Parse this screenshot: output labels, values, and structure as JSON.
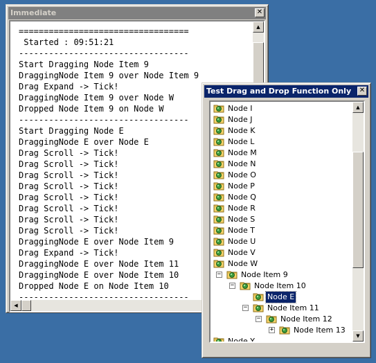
{
  "immediate": {
    "title": "Immediate",
    "close_glyph": "✕",
    "lines": [
      "==================================",
      " Started : 09:51:21",
      "----------------------------------",
      "Start Dragging Node Item 9",
      "DraggingNode Item 9 over Node Item 9",
      "Drag Expand -> Tick!",
      "DraggingNode Item 9 over Node W",
      "Dropped Node Item 9 on Node W",
      "----------------------------------",
      "Start Dragging Node E",
      "DraggingNode E over Node E",
      "Drag Scroll -> Tick!",
      "Drag Scroll -> Tick!",
      "Drag Scroll -> Tick!",
      "Drag Scroll -> Tick!",
      "Drag Scroll -> Tick!",
      "Drag Scroll -> Tick!",
      "Drag Scroll -> Tick!",
      "Drag Scroll -> Tick!",
      "DraggingNode E over Node Item 9",
      "Drag Expand -> Tick!",
      "DraggingNode E over Node Item 11",
      "DraggingNode E over Node Item 10",
      "Dropped Node E on Node Item 10",
      "----------------------------------"
    ]
  },
  "dialog": {
    "title": "Test Drag and Drop Function Only",
    "close_glyph": "✕",
    "tree": [
      {
        "label": "Node I",
        "level": 0
      },
      {
        "label": "Node J",
        "level": 0
      },
      {
        "label": "Node K",
        "level": 0
      },
      {
        "label": "Node L",
        "level": 0
      },
      {
        "label": "Node M",
        "level": 0
      },
      {
        "label": "Node N",
        "level": 0
      },
      {
        "label": "Node O",
        "level": 0
      },
      {
        "label": "Node P",
        "level": 0
      },
      {
        "label": "Node Q",
        "level": 0
      },
      {
        "label": "Node R",
        "level": 0
      },
      {
        "label": "Node S",
        "level": 0
      },
      {
        "label": "Node T",
        "level": 0
      },
      {
        "label": "Node U",
        "level": 0
      },
      {
        "label": "Node V",
        "level": 0
      },
      {
        "label": "Node W",
        "level": 0
      },
      {
        "label": "Node Item 9",
        "level": 1,
        "expander": "−"
      },
      {
        "label": "Node Item 10",
        "level": 2,
        "expander": "−"
      },
      {
        "label": "Node E",
        "level": 3,
        "selected": true
      },
      {
        "label": "Node Item 11",
        "level": 3,
        "expander": "−"
      },
      {
        "label": "Node Item 12",
        "level": 4,
        "expander": "−"
      },
      {
        "label": "Node Item 13",
        "level": 5,
        "expander": "+"
      },
      {
        "label": "Node Y",
        "level": 0
      }
    ]
  },
  "colors": {
    "desktop": "#3a6ea5",
    "active_title": "#0a246a",
    "inactive_title": "#808080",
    "selection": "#0a246a"
  }
}
